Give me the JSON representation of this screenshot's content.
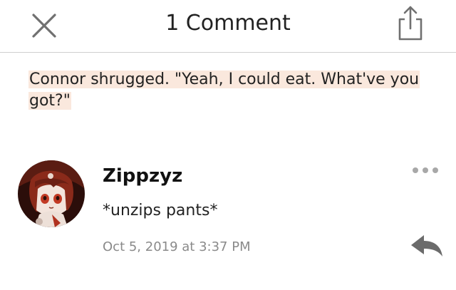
{
  "header": {
    "title": "1 Comment",
    "close_icon": "close-icon",
    "share_icon": "share-icon"
  },
  "quote": {
    "text": "Connor shrugged. \"Yeah, I could eat. What've you got?\"",
    "highlight_color": "#fae8dd"
  },
  "comment": {
    "username": "Zippzyz",
    "text": "*unzips pants*",
    "timestamp": "Oct 5, 2019 at 3:37 PM",
    "more_icon": "more-icon",
    "reply_icon": "reply-icon"
  },
  "colors": {
    "text": "#222222",
    "secondary": "#8a8a8a",
    "icon": "#6b6b6b",
    "divider": "#cfcfcf"
  }
}
